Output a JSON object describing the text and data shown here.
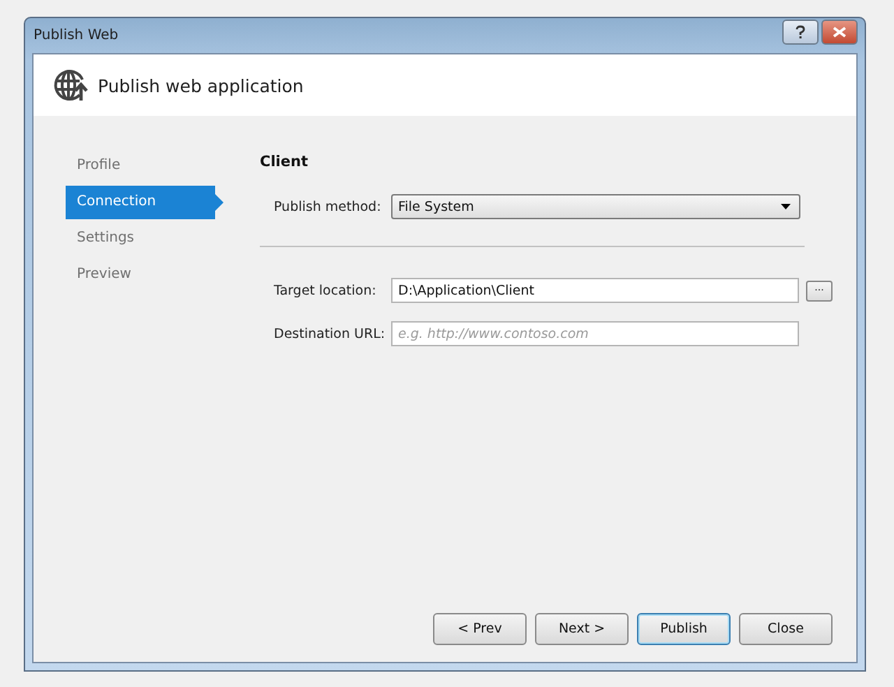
{
  "window": {
    "title": "Publish Web"
  },
  "header": {
    "title": "Publish web application"
  },
  "sidebar": {
    "items": [
      {
        "label": "Profile",
        "selected": false
      },
      {
        "label": "Connection",
        "selected": true
      },
      {
        "label": "Settings",
        "selected": false
      },
      {
        "label": "Preview",
        "selected": false
      }
    ]
  },
  "section_title": "Client",
  "publish_method": {
    "label": "Publish method:",
    "value": "File System"
  },
  "target_location": {
    "label": "Target location:",
    "value": "D:\\Application\\Client",
    "browse": "..."
  },
  "destination_url": {
    "label": "Destination URL:",
    "placeholder": "e.g. http://www.contoso.com"
  },
  "buttons": [
    {
      "label": "< Prev",
      "default": false
    },
    {
      "label": "Next >",
      "default": false
    },
    {
      "label": "Publish",
      "default": true
    },
    {
      "label": "Close",
      "default": false
    }
  ]
}
